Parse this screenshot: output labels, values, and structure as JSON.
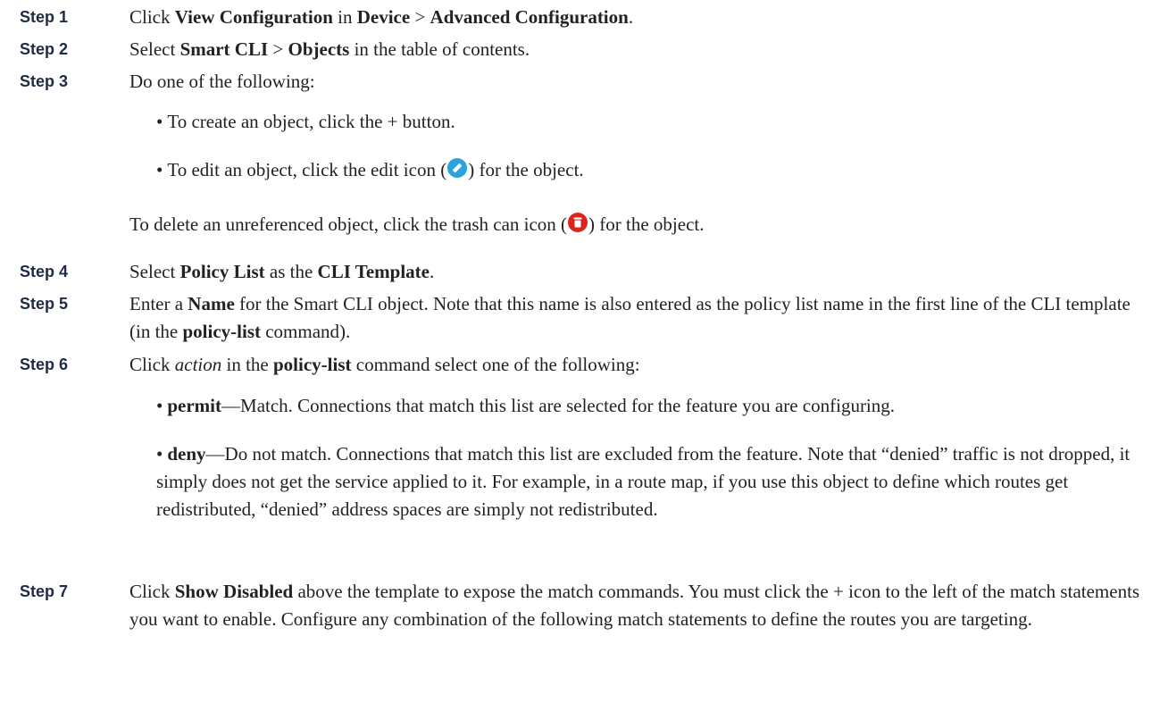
{
  "steps": {
    "s1": {
      "label": "Step 1",
      "t1": "Click ",
      "b1": "View Configuration",
      "t2": " in ",
      "b2": "Device",
      "t3": " > ",
      "b3": "Advanced Configuration",
      "t4": "."
    },
    "s2": {
      "label": "Step 2",
      "t1": "Select ",
      "b1": "Smart CLI",
      "t2": " > ",
      "b2": "Objects",
      "t3": " in the table of contents."
    },
    "s3": {
      "label": "Step 3",
      "text": "Do one of the following:",
      "bullet1": "To create an object, click the + button.",
      "bullet2_pre": "To edit an object, click the edit icon (",
      "bullet2_post": ") for the object.",
      "note_pre": "To delete an unreferenced object, click the trash can icon (",
      "note_post": ") for the object."
    },
    "s4": {
      "label": "Step 4",
      "t1": "Select ",
      "b1": "Policy List",
      "t2": " as the ",
      "b2": "CLI Template",
      "t3": "."
    },
    "s5": {
      "label": "Step 5",
      "t1": "Enter a ",
      "b1": "Name",
      "t2": " for the Smart CLI object. Note that this name is also entered as the policy list name in the first line of the CLI template (in the ",
      "b2": "policy-list",
      "t3": " command)."
    },
    "s6": {
      "label": "Step 6",
      "t1": "Click ",
      "i1": "action",
      "t2": " in the ",
      "b1": "policy-list",
      "t3": " command select one of the following:",
      "permit_label": "permit",
      "permit_text": "—Match. Connections that match this list are selected for the feature you are configuring.",
      "deny_label": "deny",
      "deny_text": "—Do not match. Connections that match this list are excluded from the feature. Note that “denied” traffic is not dropped, it simply does not get the service applied to it. For example, in a route map, if you use this object to define which routes get redistributed, “denied” address spaces are simply not redistributed."
    },
    "s7": {
      "label": "Step 7",
      "t1": "Click ",
      "b1": "Show Disabled",
      "t2": " above the template to expose the match commands. You must click the + icon to the left of the match statements you want to enable. Configure any combination of the following match statements to define the routes you are targeting."
    }
  },
  "bullet_char": "•",
  "icons": {
    "edit": "edit-icon",
    "trash": "trash-can-icon",
    "edit_color": "#2aa3dc",
    "trash_color": "#d9261c"
  }
}
